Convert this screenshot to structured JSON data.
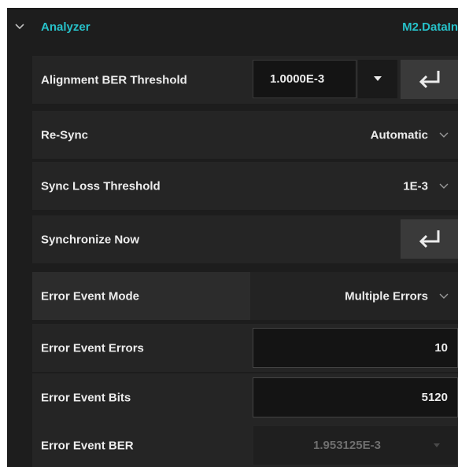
{
  "header": {
    "title": "Analyzer",
    "target": "M2.DataIn"
  },
  "rows": [
    {
      "label": "Alignment BER Threshold",
      "value": "1.0000E-3"
    },
    {
      "label": "Re-Sync",
      "value": "Automatic"
    },
    {
      "label": "Sync Loss Threshold",
      "value": "1E-3"
    },
    {
      "label": "Synchronize Now"
    },
    {
      "label": "Error Event Mode",
      "value": "Multiple Errors"
    },
    {
      "label": "Error Event Errors",
      "value": "10"
    },
    {
      "label": "Error Event Bits",
      "value": "5120"
    },
    {
      "label": "Error Event BER",
      "value": "1.953125E-3"
    }
  ],
  "colors": {
    "accent": "#27c1c9",
    "panel_bg": "#1d1d1d",
    "row_bg": "#252525",
    "text": "#ececec",
    "disabled_text": "#6e6e6e"
  },
  "icons": {
    "section_toggle": "chevron-down-icon",
    "dropdown": "chevron-down-icon",
    "apply": "enter-arrow-icon"
  }
}
